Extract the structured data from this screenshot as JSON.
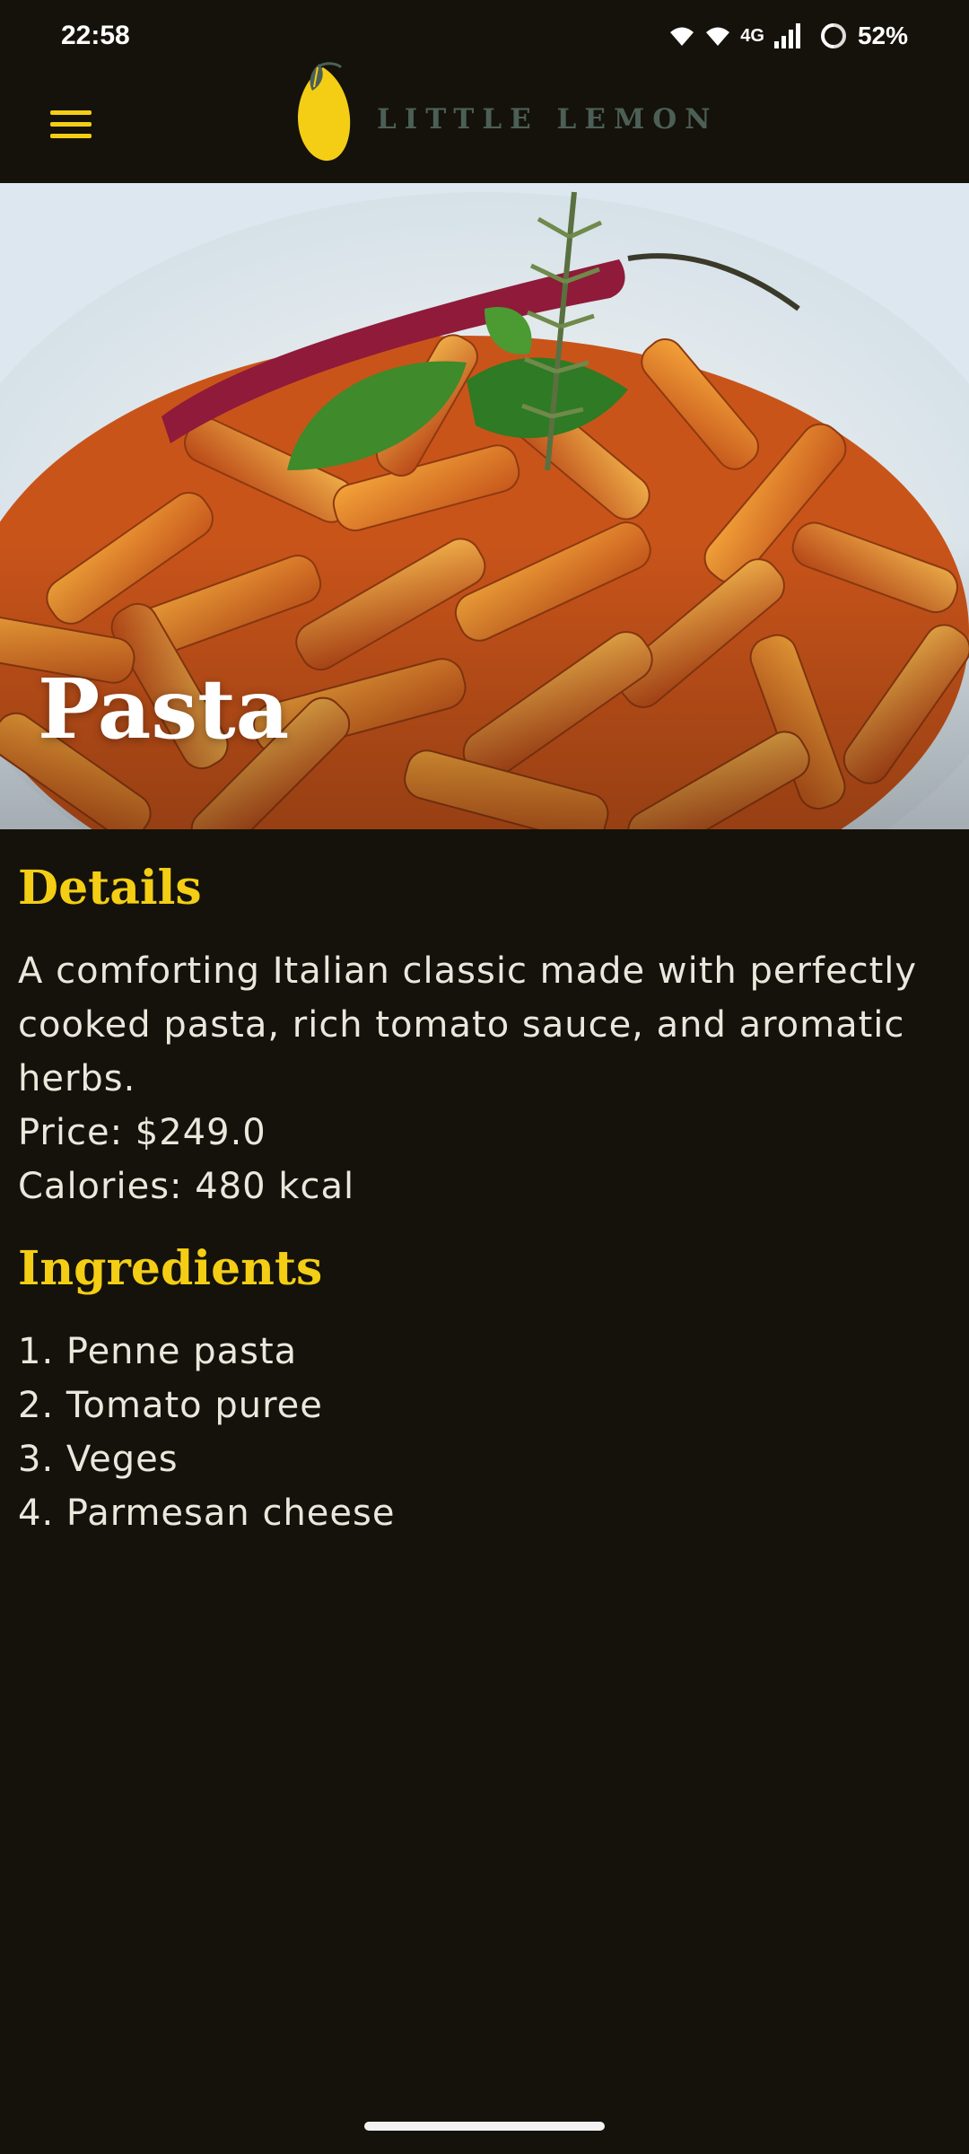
{
  "status_bar": {
    "time": "22:58",
    "network": "4G",
    "battery": "52%"
  },
  "app_bar": {
    "logo_text": "LITTLE LEMON",
    "brand_yellow": "#f4ce14",
    "brand_green": "#4c5f56"
  },
  "hero": {
    "title": "Pasta"
  },
  "details": {
    "heading": "Details",
    "description": "A comforting Italian classic made with perfectly cooked pasta, rich tomato sauce, and aromatic herbs.",
    "price": "Price: $249.0",
    "calories": "Calories: 480 kcal"
  },
  "ingredients": {
    "heading": "Ingredients",
    "items": [
      "1. Penne pasta",
      "2. Tomato puree",
      "3. Veges",
      "4. Parmesan cheese"
    ]
  }
}
